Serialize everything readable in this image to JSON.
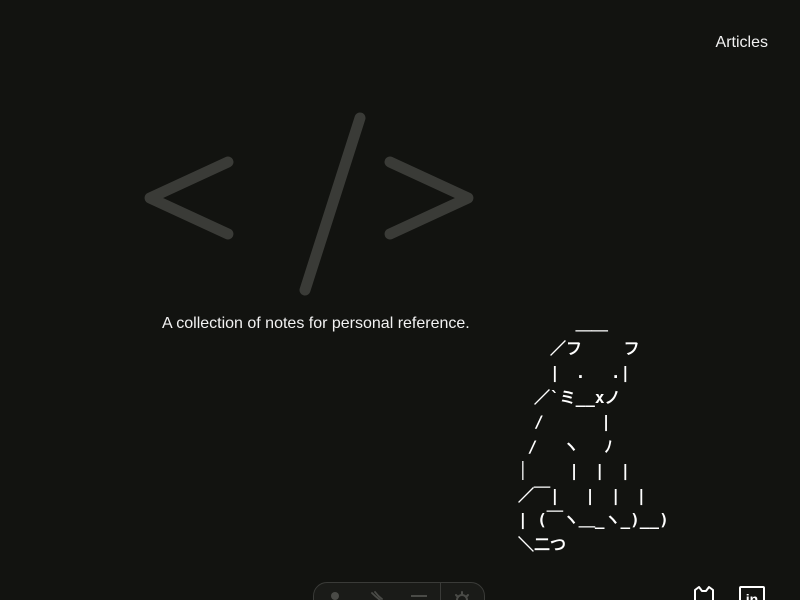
{
  "nav": {
    "articles_label": "Articles"
  },
  "logo": {
    "icon": "code-brackets-icon",
    "color": "#3a3b37"
  },
  "tagline": "A collection of notes for personal reference.",
  "ascii_art": "      ＿＿\n　　／フ　　 フ\n　　|　.　 .|\n　／`ミ__xノ\n　/　　　 |\n /　 ヽ　 ﾉ\n│　 　|　|　|\n／￣|　 |　|　|\n| (￣ヽ＿_ヽ_)__)\n＼二つ",
  "toolbar": {
    "items": [
      {
        "icon": "person-icon"
      },
      {
        "icon": "rabbit-icon"
      },
      {
        "icon": "menu-icon"
      },
      {
        "icon": "settings-icon"
      }
    ]
  },
  "social": {
    "github_icon": "github-icon",
    "linkedin_icon": "linkedin-icon",
    "linkedin_text": "in"
  },
  "colors": {
    "background": "#121310",
    "text": "#f2f2f2",
    "muted": "#3a3b37"
  }
}
